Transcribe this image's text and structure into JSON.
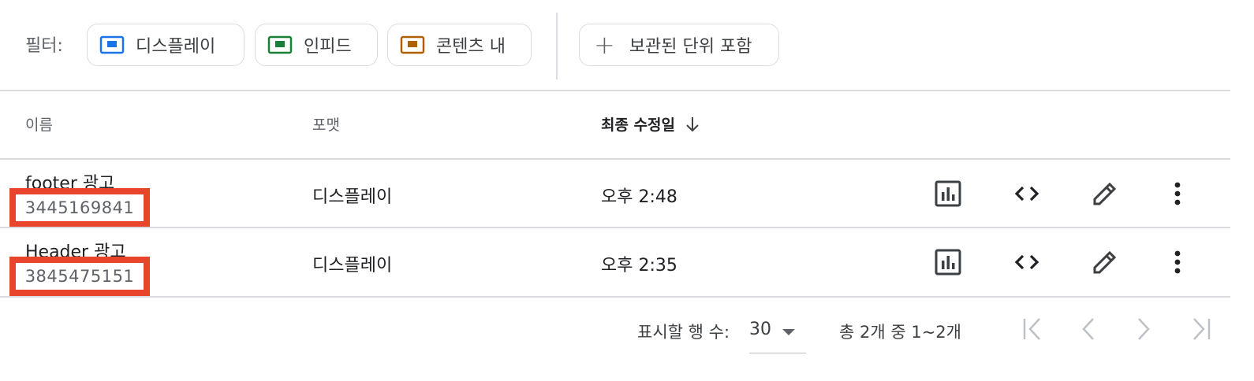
{
  "filters": {
    "label": "필터:",
    "chips": [
      {
        "label": "디스플레이",
        "icon": "display-ad-icon",
        "color": "#1a73e8"
      },
      {
        "label": "인피드",
        "icon": "infeed-ad-icon",
        "color": "#188038"
      },
      {
        "label": "콘텐츠 내",
        "icon": "incontent-ad-icon",
        "color": "#b06000"
      }
    ],
    "archive_button": {
      "icon": "plus-icon",
      "label": "보관된 단위 포함"
    }
  },
  "table": {
    "columns": {
      "name": "이름",
      "format": "포맷",
      "modified": "최종 수정일"
    },
    "sort_icon": "arrow-down-icon",
    "rows": [
      {
        "name": "footer 광고",
        "id": "3445169841",
        "format": "디스플레이",
        "modified": "오후 2:48"
      },
      {
        "name": "Header 광고",
        "id": "3845475151",
        "format": "디스플레이",
        "modified": "오후 2:35"
      }
    ],
    "row_actions": [
      "bar-chart-icon",
      "code-icon",
      "edit-pencil-icon",
      "more-vert-icon"
    ]
  },
  "pagination": {
    "rows_per_page_label": "표시할 행 수:",
    "rows_per_page_value": "30",
    "range_text": "총 2개 중 1~2개",
    "icons": [
      "first-page-icon",
      "prev-page-icon",
      "next-page-icon",
      "last-page-icon"
    ]
  },
  "colors": {
    "highlight": "#e8452c",
    "divider": "#dadce0",
    "icon_dark": "#3c4043",
    "icon_disabled": "#bdc1c6"
  }
}
